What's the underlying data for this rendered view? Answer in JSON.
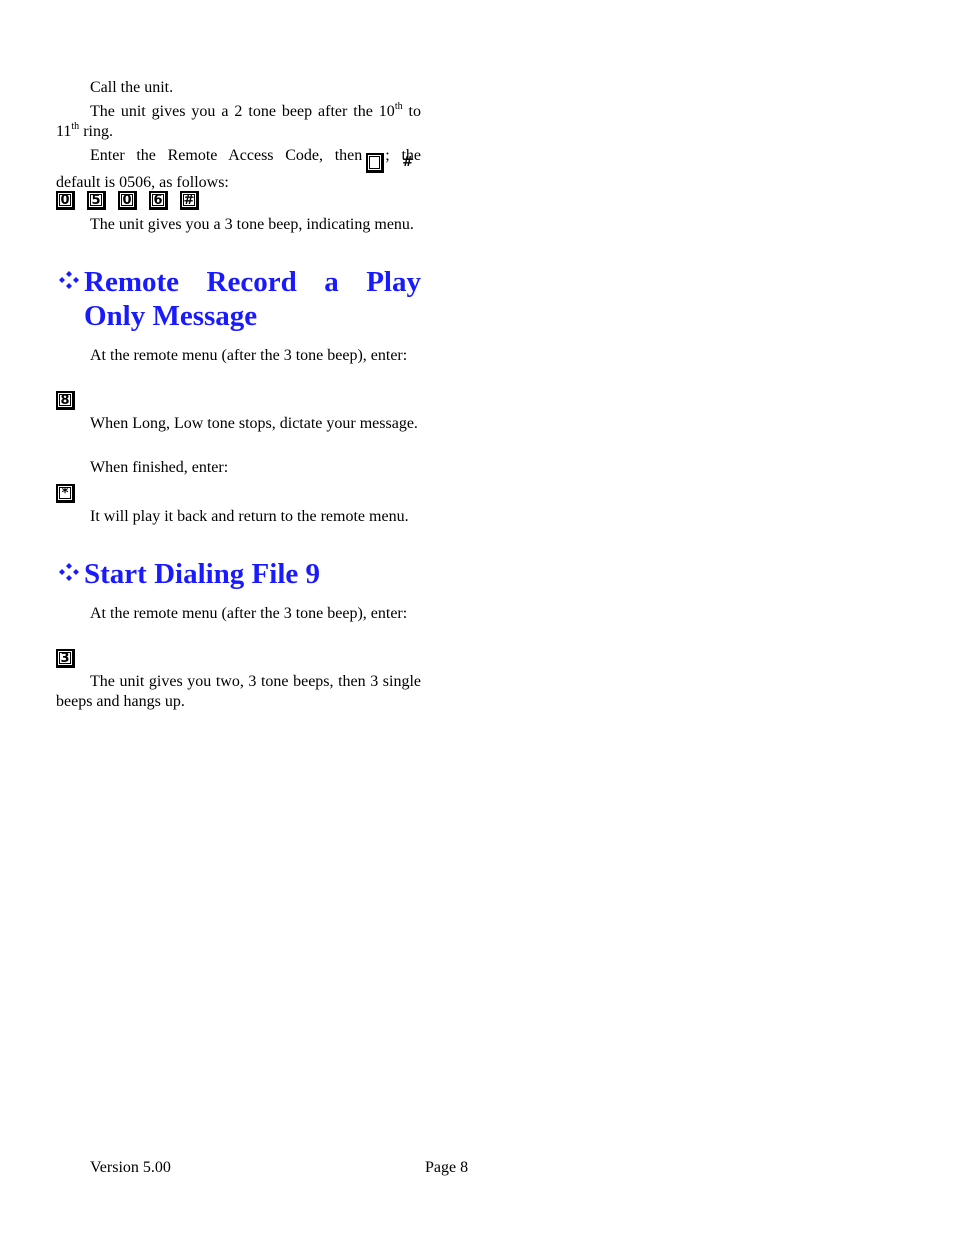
{
  "document": {
    "sections": {
      "intro": {
        "p1": "Call the unit.",
        "p2_before": "The unit gives you a 2 tone beep after the 10",
        "p2_sup1": "th",
        "p2_mid": " to 11",
        "p2_sup2": "th",
        "p2_after": " ring.",
        "p3_before": "Enter the Remote Access Code, then",
        "p3_key": "#",
        "p3_after": "; the default is 0506, as follows:",
        "code_keys": [
          "0",
          "5",
          "0",
          "6",
          "#"
        ],
        "p4": "The unit gives you a 3 tone beep, indicating menu."
      },
      "remote_record": {
        "heading_words": [
          "Remote",
          "Record",
          "a",
          "Play"
        ],
        "heading_line2": "Only Message",
        "p1": "At the remote menu (after the 3 tone beep), enter:",
        "key1": "8",
        "p2": "When Long, Low tone stops, dictate your message.",
        "p3": "When finished, enter:",
        "key2": "*",
        "p4": "It will play it back and return to the remote menu."
      },
      "start_dialing": {
        "heading": "Start Dialing File 9",
        "p1": "At the remote menu (after the 3 tone beep), enter:",
        "key1": "3",
        "p2": "The unit gives you two, 3 tone beeps, then 3 single beeps and hangs up."
      }
    },
    "footer": {
      "version": "Version 5.00",
      "page": "Page 8"
    },
    "colors": {
      "heading": "#1a1aff",
      "text": "#000000"
    }
  }
}
